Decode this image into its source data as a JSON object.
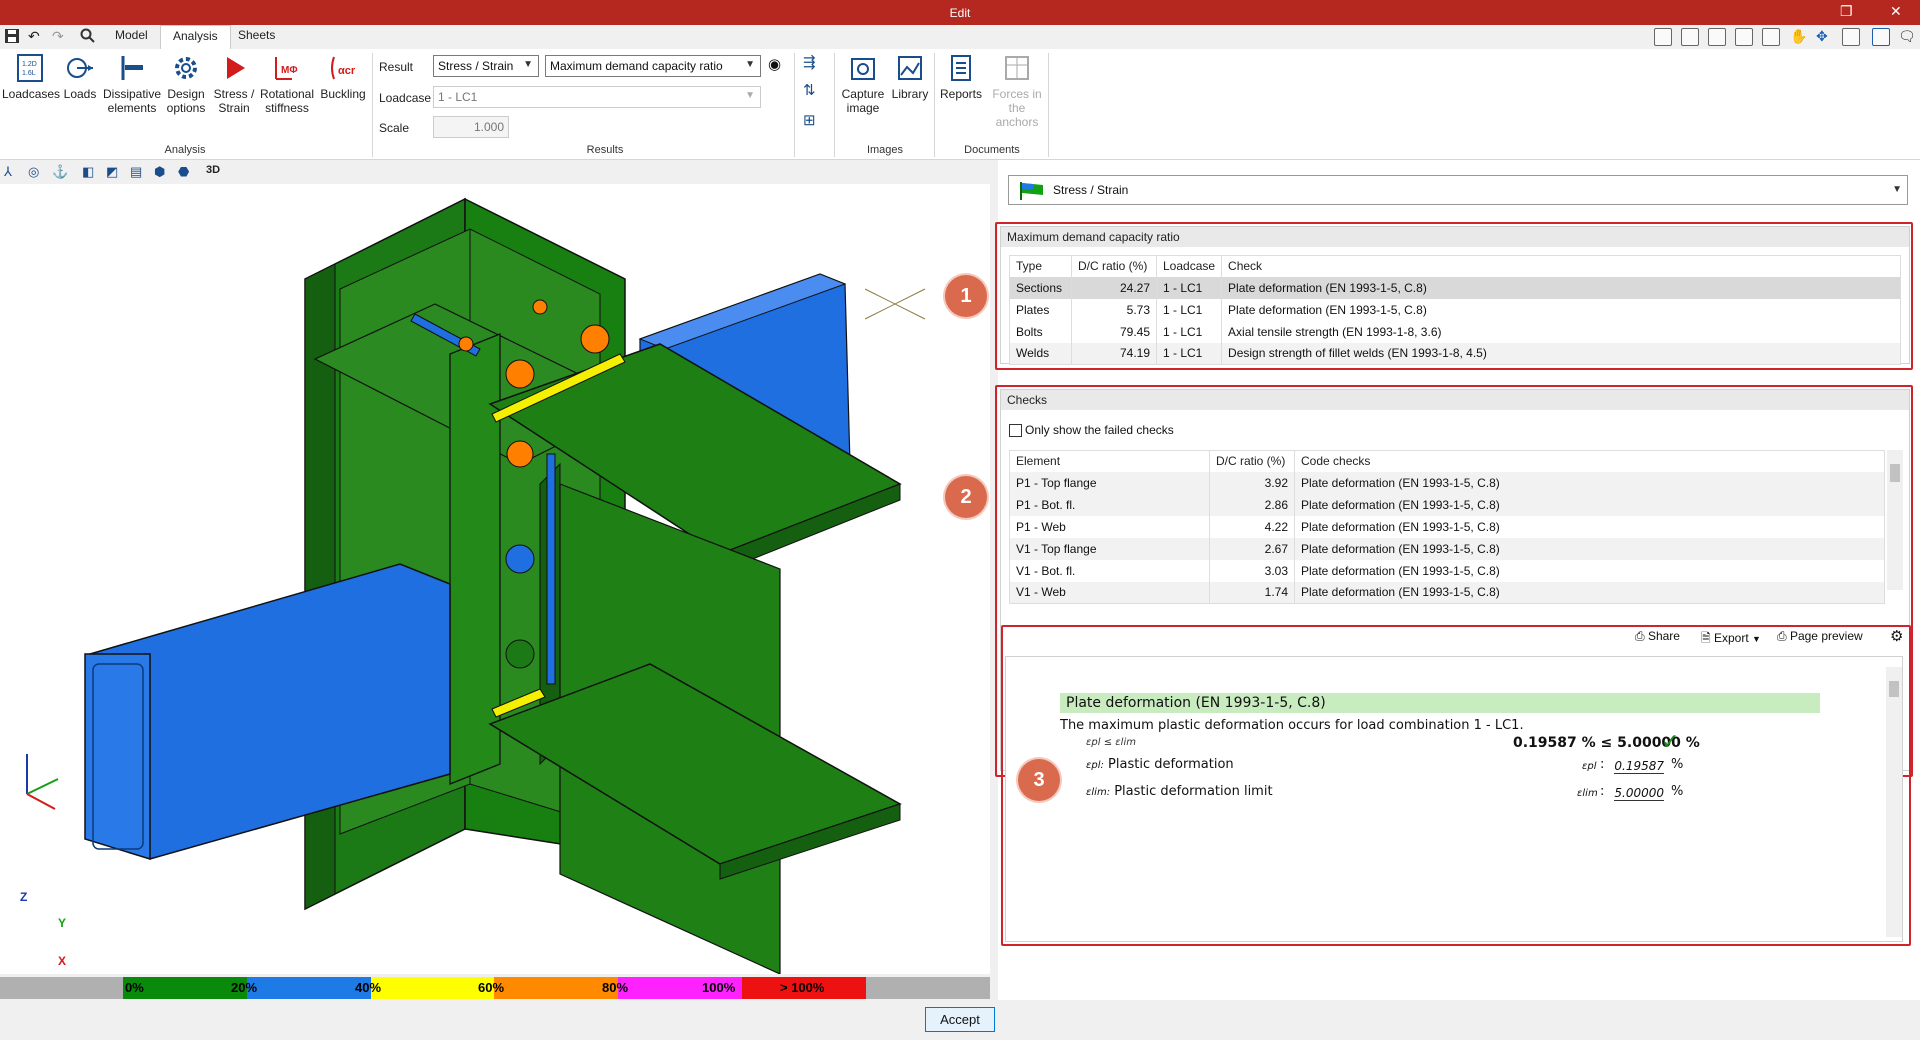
{
  "window": {
    "title": "Edit"
  },
  "tabs": [
    {
      "label": "Model"
    },
    {
      "label": "Analysis"
    },
    {
      "label": "Sheets"
    }
  ],
  "ribbon": {
    "analysis_buttons": [
      {
        "label": "Loadcases",
        "icon": "loadcases-icon"
      },
      {
        "label": "Loads",
        "icon": "loads-icon"
      },
      {
        "label": "Dissipative elements",
        "icon": "dissipative-icon"
      },
      {
        "label": "Design options",
        "icon": "gear-icon"
      },
      {
        "label": "Stress / Strain",
        "icon": "play-icon"
      },
      {
        "label": "Rotational stiffness",
        "icon": "rotational-stiffness-icon"
      },
      {
        "label": "Buckling",
        "icon": "buckling-icon"
      }
    ],
    "group_analysis": "Analysis",
    "group_results": "Results",
    "group_images": "Images",
    "group_documents": "Documents",
    "result_label": "Result",
    "result_value": "Stress / Strain",
    "result_mode": "Maximum demand capacity ratio",
    "loadcase_label": "Loadcase",
    "loadcase_value": "1 - LC1",
    "scale_label": "Scale",
    "scale_value": "1.000",
    "image_buttons": [
      {
        "label": "Capture image"
      },
      {
        "label": "Library"
      }
    ],
    "document_buttons": [
      {
        "label": "Reports"
      },
      {
        "label": "Forces in the anchors"
      }
    ]
  },
  "colorbar": {
    "segments": [
      {
        "label": "0%",
        "color": "#0a8a0a"
      },
      {
        "label": "20%",
        "color": "#0a8a0a"
      },
      {
        "label": "40%",
        "color": "#1e7be6"
      },
      {
        "label": "60%",
        "color": "#ffff00"
      },
      {
        "label": "80%",
        "color": "#ff8a00"
      },
      {
        "label": "100%",
        "color": "#ff22ff"
      },
      {
        "label": "> 100%",
        "color": "#ee1111"
      }
    ]
  },
  "axes": {
    "z": "Z",
    "y": "Y",
    "x": "X"
  },
  "right": {
    "view_select": "Stress / Strain",
    "summary": {
      "title": "Maximum demand capacity ratio",
      "columns": [
        "Type",
        "D/C ratio (%)",
        "Loadcase",
        "Check"
      ],
      "rows": [
        [
          "Sections",
          "24.27",
          "1 - LC1",
          "Plate deformation (EN 1993-1-5, C.8)"
        ],
        [
          "Plates",
          "5.73",
          "1 - LC1",
          "Plate deformation (EN 1993-1-5, C.8)"
        ],
        [
          "Bolts",
          "79.45",
          "1 - LC1",
          "Axial tensile strength (EN 1993-1-8, 3.6)"
        ],
        [
          "Welds",
          "74.19",
          "1 - LC1",
          "Design strength of fillet welds (EN 1993-1-8, 4.5)"
        ]
      ]
    },
    "checks": {
      "title": "Checks",
      "only_failed": "Only show the failed checks",
      "columns": [
        "Element",
        "D/C ratio (%)",
        "Code checks"
      ],
      "rows": [
        [
          "P1 - Top flange",
          "3.92",
          "Plate deformation (EN 1993-1-5, C.8)"
        ],
        [
          "P1 - Bot. fl.",
          "2.86",
          "Plate deformation (EN 1993-1-5, C.8)"
        ],
        [
          "P1 - Web",
          "4.22",
          "Plate deformation (EN 1993-1-5, C.8)"
        ],
        [
          "V1 - Top flange",
          "2.67",
          "Plate deformation (EN 1993-1-5, C.8)"
        ],
        [
          "V1 - Bot. fl.",
          "3.03",
          "Plate deformation (EN 1993-1-5, C.8)"
        ],
        [
          "V1 - Web",
          "1.74",
          "Plate deformation (EN 1993-1-5, C.8)"
        ]
      ]
    },
    "report_toolbar": {
      "share": "Share",
      "export": "Export",
      "preview": "Page preview"
    },
    "report": {
      "heading": "Plate deformation (EN 1993-1-5, C.8)",
      "sentence": "The maximum plastic deformation occurs for load combination 1 - LC1.",
      "condition": "εpl ≤ εlim",
      "result": "0.19587 % ≤ 5.00000 %",
      "row1_symbol": "εpl:",
      "row1_label": "Plastic deformation",
      "row1_sym_r": "εpl",
      "row1_value": "0.19587",
      "row2_symbol": "εlim:",
      "row2_label": "Plastic deformation limit",
      "row2_sym_r": "εlim",
      "row2_value": "5.00000",
      "unit": "%",
      "colon": ":"
    },
    "badges": [
      "1",
      "2",
      "3"
    ]
  },
  "accept_label": "Accept"
}
